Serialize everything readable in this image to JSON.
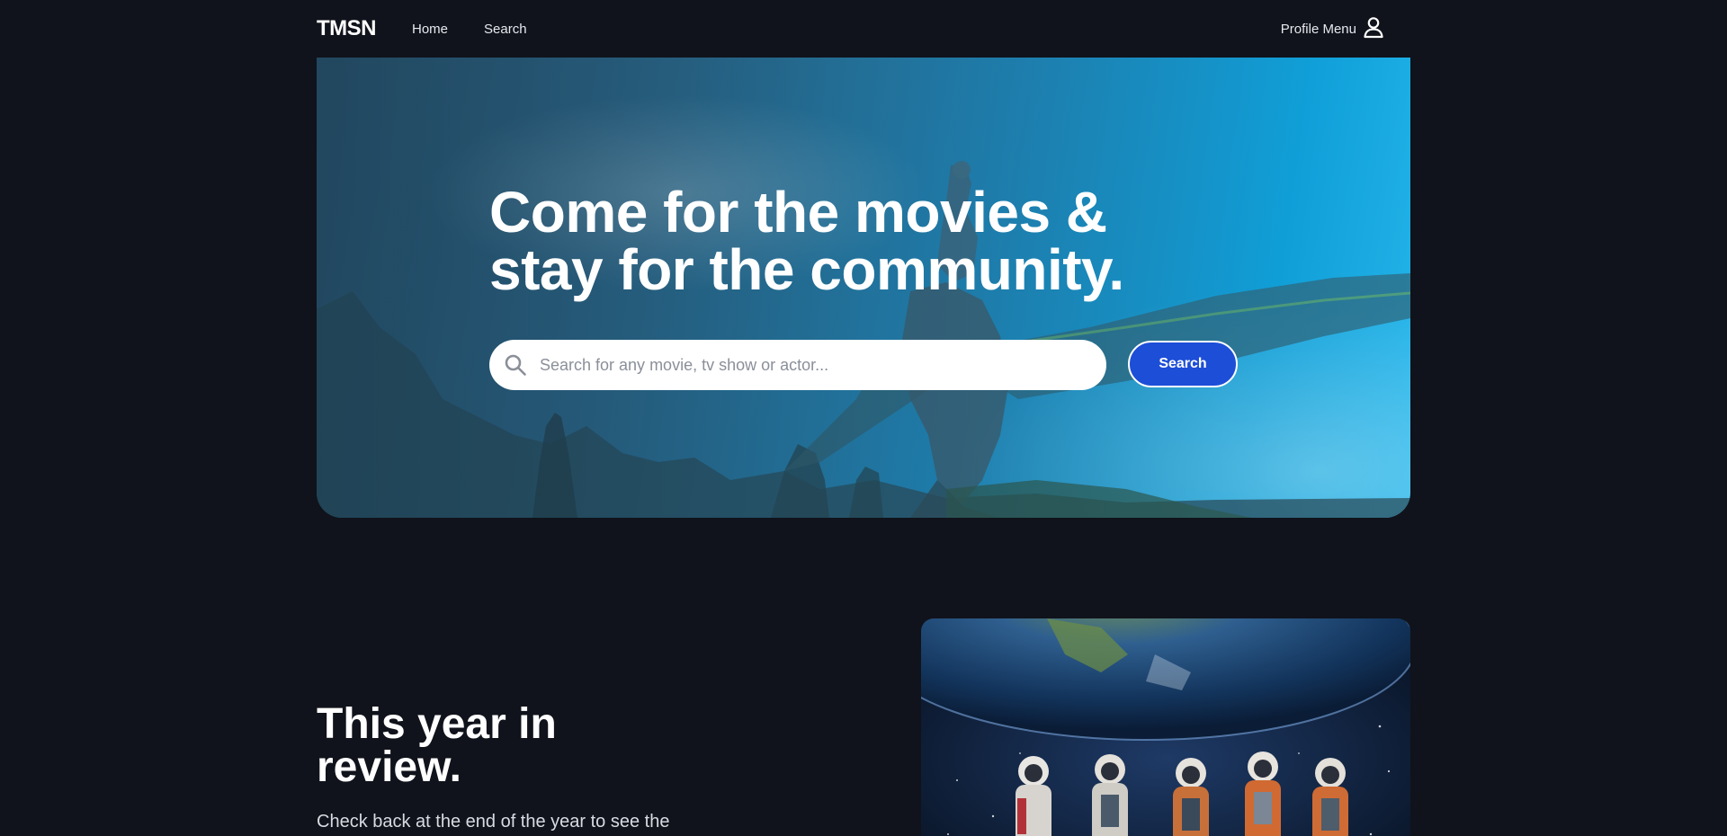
{
  "nav": {
    "logo": "TMSN",
    "links": [
      "Home",
      "Search"
    ],
    "profile_label": "Profile Menu",
    "profile_icon": "user-icon"
  },
  "hero": {
    "title_line1": "Come for the movies &",
    "title_line2": "stay for the community.",
    "search_placeholder": "Search for any movie, tv show or actor...",
    "search_value": "",
    "search_icon": "search-icon",
    "search_button": "Search",
    "accent": "#1d4ed8"
  },
  "review": {
    "title_line1": "This year in",
    "title_line2": "review.",
    "text": "Check back at the end of the year to see the"
  },
  "colors": {
    "background": "#10131b",
    "text": "#ffffff"
  }
}
